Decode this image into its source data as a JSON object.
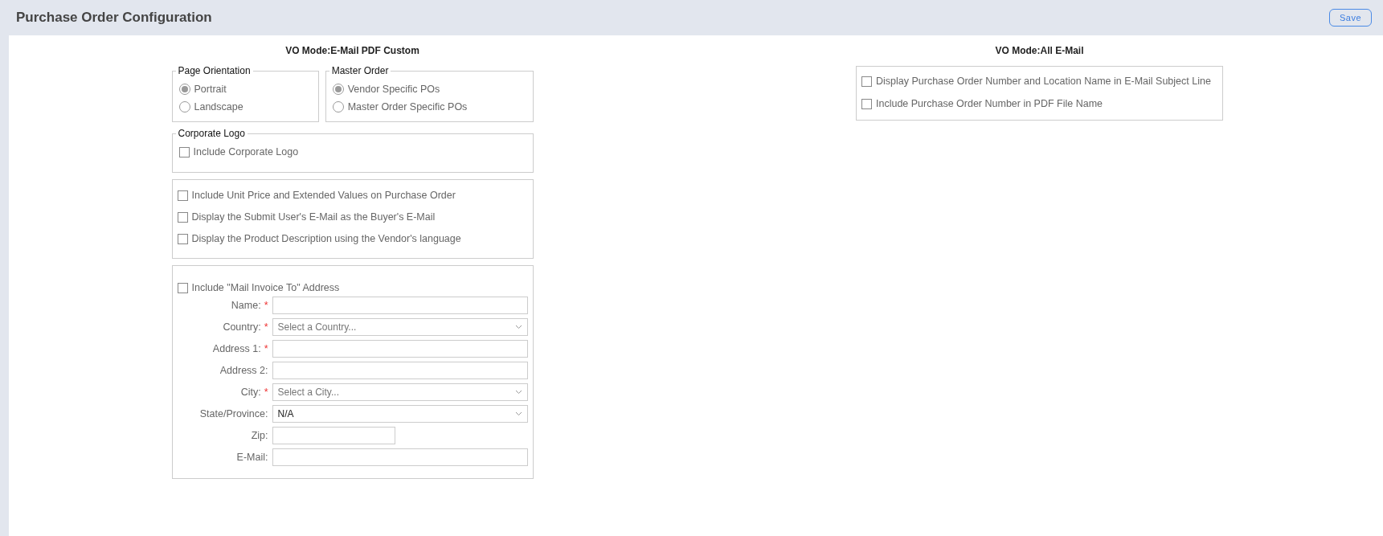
{
  "header": {
    "title": "Purchase Order Configuration",
    "save_button": "Save"
  },
  "left": {
    "title": "VO Mode:E-Mail PDF Custom",
    "radio_groups": [
      {
        "legend": "Page Orientation",
        "options": [
          {
            "label": "Portrait",
            "selected": true
          },
          {
            "label": "Landscape",
            "selected": false
          }
        ]
      },
      {
        "legend": "Master Order",
        "options": [
          {
            "label": "Vendor Specific POs",
            "selected": true
          },
          {
            "label": "Master Order Specific POs",
            "selected": false
          }
        ]
      }
    ],
    "corporate_logo": {
      "legend": "Corporate Logo",
      "option": {
        "label": "Include Corporate Logo",
        "checked": false
      }
    },
    "options": [
      {
        "label": "Include Unit Price and Extended Values on Purchase Order",
        "checked": false
      },
      {
        "label": "Display the Submit User's E-Mail as the Buyer's E-Mail",
        "checked": false
      },
      {
        "label": "Display the Product Description using the Vendor's language",
        "checked": false
      }
    ],
    "mail_invoice": {
      "option": {
        "label": "Include \"Mail Invoice To\" Address",
        "checked": false
      },
      "fields": [
        {
          "label": "Name:",
          "required_mark": "*",
          "kind": "text"
        },
        {
          "label": "Country:",
          "required_mark": "*",
          "kind": "select",
          "placeholder": "Select a Country..."
        },
        {
          "label": "Address 1:",
          "required_mark": "*",
          "kind": "text"
        },
        {
          "label": "Address 2:",
          "kind": "text"
        },
        {
          "label": "City:",
          "required_mark": "*",
          "kind": "select",
          "placeholder": "Select a City..."
        },
        {
          "label": "State/Province:",
          "kind": "select",
          "value": "N/A"
        },
        {
          "label": "Zip:",
          "kind": "short"
        },
        {
          "label": "E-Mail:",
          "kind": "text"
        }
      ]
    }
  },
  "right": {
    "title": "VO Mode:All E-Mail",
    "options": [
      {
        "label": "Display Purchase Order Number and Location Name in E-Mail Subject Line",
        "checked": false
      },
      {
        "label": "Include Purchase Order Number in PDF File Name",
        "checked": false
      }
    ]
  }
}
